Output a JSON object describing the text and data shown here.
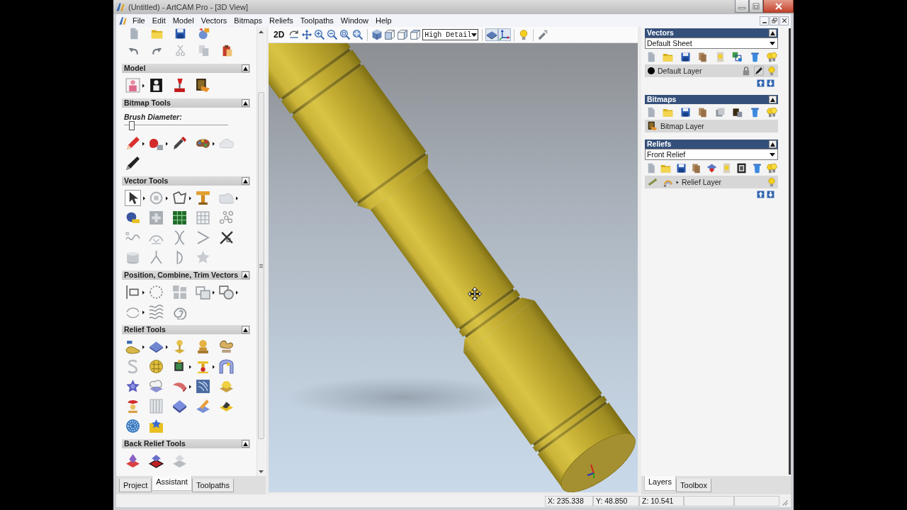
{
  "window": {
    "title": "(Untitled) - ArtCAM Pro - [3D View]"
  },
  "menu": [
    "File",
    "Edit",
    "Model",
    "Vectors",
    "Bitmaps",
    "Reliefs",
    "Toolpaths",
    "Window",
    "Help"
  ],
  "assistant": {
    "sections": [
      {
        "title": "Model",
        "expanded": true
      },
      {
        "title": "Bitmap Tools",
        "expanded": true,
        "brush": {
          "label": "Brush Diameter:",
          "level": 0.05
        }
      },
      {
        "title": "Vector Tools",
        "expanded": true
      },
      {
        "title": "Position, Combine, Trim Vectors",
        "expanded": true
      },
      {
        "title": "Relief Tools",
        "expanded": true
      },
      {
        "title": "Back Relief Tools",
        "expanded": true
      }
    ],
    "tabs": [
      {
        "label": "Project",
        "selected": false
      },
      {
        "label": "Assistant",
        "selected": true
      },
      {
        "label": "Toolpaths",
        "selected": false
      }
    ]
  },
  "view": {
    "mode_button": "2D",
    "detail": "High Detail"
  },
  "layer_groups": [
    {
      "kind": "vector",
      "title": "Vectors",
      "expanded": true,
      "sheet": "Default Sheet",
      "layers": [
        {
          "name": "Default Layer",
          "color": "#000000"
        }
      ]
    },
    {
      "kind": "bitmap",
      "title": "Bitmaps",
      "expanded": true,
      "layers": [
        {
          "name": "Bitmap Layer"
        }
      ]
    },
    {
      "kind": "relief",
      "title": "Reliefs",
      "expanded": true,
      "sheet": "Front Relief",
      "layers": [
        {
          "name": "Relief Layer",
          "expanded": false
        }
      ]
    }
  ],
  "side_tabs": [
    {
      "label": "Layers",
      "selected": true
    },
    {
      "label": "Toolbox",
      "selected": false
    }
  ],
  "status_bar": {
    "readouts": [
      "X: 235.338",
      "Y: 48.850",
      "Z: 10.541"
    ]
  }
}
